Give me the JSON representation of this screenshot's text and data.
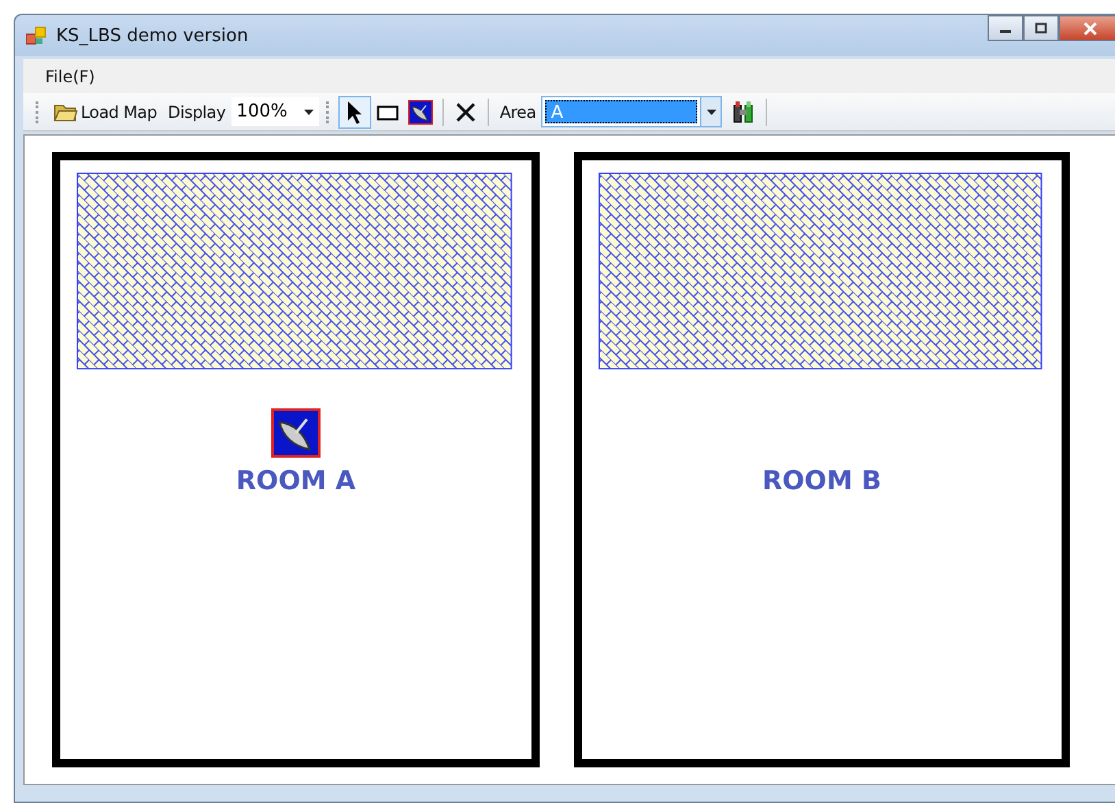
{
  "window": {
    "title": "KS_LBS demo version"
  },
  "menu": [
    {
      "label": "File(F)"
    }
  ],
  "toolbar": {
    "load_map": "Load Map",
    "display_label": "Display",
    "zoom": "100%",
    "tools": [
      {
        "kind": "pointer",
        "selected": true
      },
      {
        "kind": "rectangle",
        "selected": false
      },
      {
        "kind": "antenna",
        "selected": false
      },
      {
        "kind": "delete",
        "selected": false
      }
    ],
    "area_label": "Area",
    "area": {
      "value": "A",
      "selected": true
    }
  },
  "rooms": [
    {
      "name": "ROOM A",
      "beacon": true
    },
    {
      "name": "ROOM B",
      "beacon": false
    }
  ]
}
